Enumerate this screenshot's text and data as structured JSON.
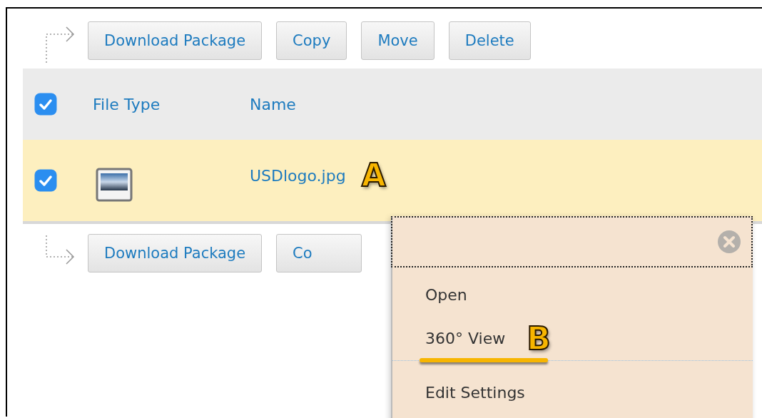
{
  "top_toolbar": {
    "buttons": [
      "Download Package",
      "Copy",
      "Move",
      "Delete"
    ]
  },
  "table": {
    "header_checked": true,
    "columns": [
      "File Type",
      "Name"
    ],
    "rows": [
      {
        "checked": true,
        "selected": true,
        "name": "USDlogo.jpg",
        "annotation": "A"
      }
    ]
  },
  "bottom_toolbar": {
    "buttons": [
      "Download Package",
      "Co"
    ]
  },
  "context_menu": {
    "items": [
      {
        "label": "Open",
        "underlined": false,
        "separator_after": false
      },
      {
        "label": "360° View",
        "annotation": "B",
        "underlined": true,
        "separator_after": true
      },
      {
        "label": "Edit Settings",
        "underlined": false,
        "separator_after": false
      }
    ]
  }
}
